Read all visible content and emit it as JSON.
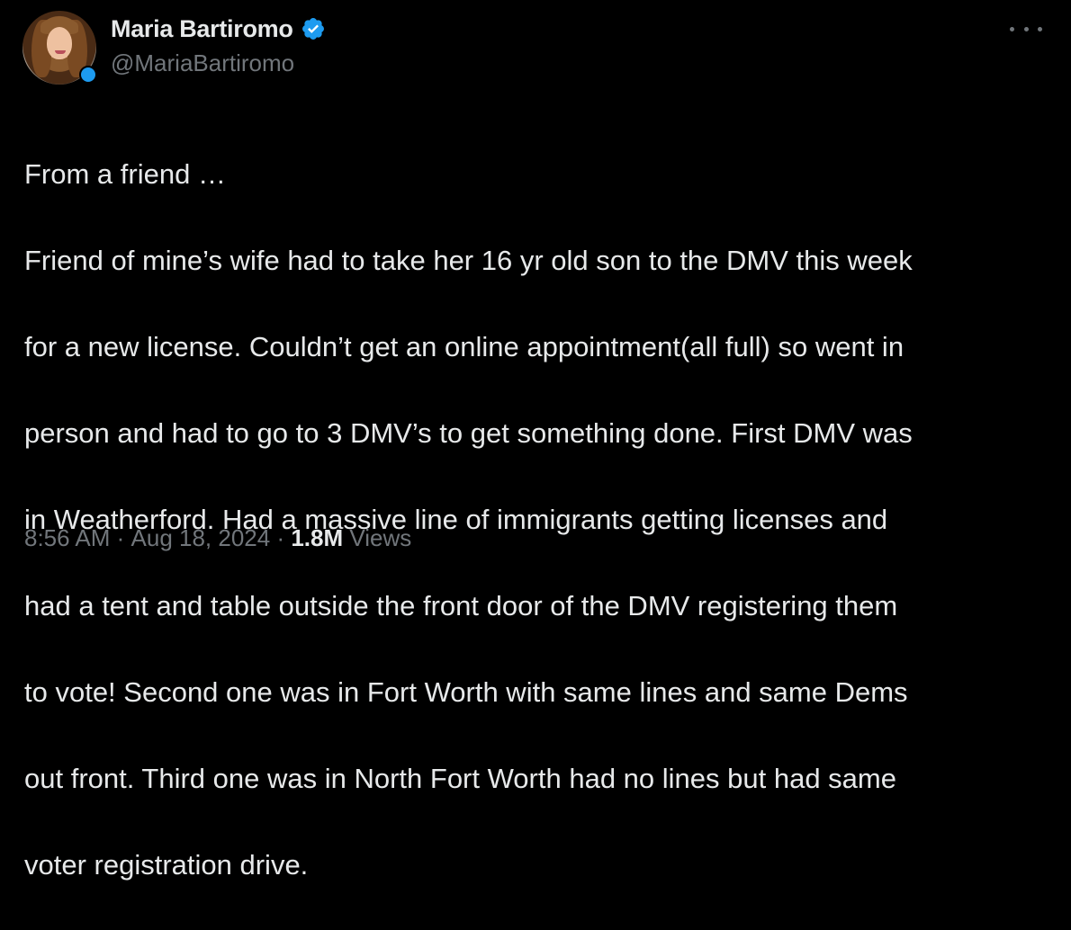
{
  "author": {
    "display_name": "Maria Bartiromo",
    "handle": "@MariaBartiromo",
    "verified": true,
    "verified_color": "#1d9bf0"
  },
  "menu": {
    "icon": "more-icon"
  },
  "tweet": {
    "lines": [
      "From a friend …",
      "Friend of mine’s wife had to take her 16 yr old son to the DMV this week",
      "for a new license. Couldn’t get an online appointment(all full) so went in",
      "person and had to go to 3 DMV’s to get something done. First DMV was",
      "in Weatherford. Had a massive line of immigrants getting licenses and",
      "had a tent and table outside the front door of the DMV registering them",
      "to vote! Second one was in Fort Worth with same lines and same Dems",
      "out front. Third one was in North Fort Worth had no lines but had same",
      "voter registration drive."
    ]
  },
  "meta": {
    "time": "8:56 AM",
    "separator": " · ",
    "date": "Aug 18, 2024",
    "views_count": "1.8M",
    "views_label": "Views"
  },
  "colors": {
    "background": "#000000",
    "primary_text": "#e7e9ea",
    "secondary_text": "#71767b"
  }
}
